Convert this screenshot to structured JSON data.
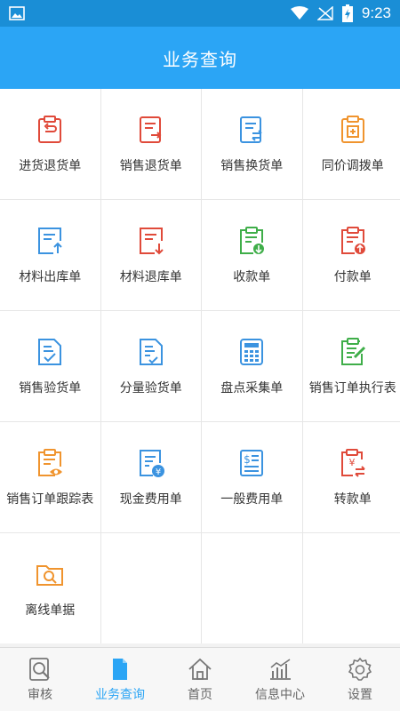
{
  "status_bar": {
    "time": "9:23"
  },
  "app_bar": {
    "title": "业务查询"
  },
  "grid": [
    {
      "label": "进货退货单",
      "icon": "return-purchase-icon",
      "color": "#e04a3a"
    },
    {
      "label": "销售退货单",
      "icon": "sales-return-icon",
      "color": "#e04a3a"
    },
    {
      "label": "销售换货单",
      "icon": "sales-exchange-icon",
      "color": "#3b93e0"
    },
    {
      "label": "同价调拨单",
      "icon": "transfer-icon",
      "color": "#f0942e"
    },
    {
      "label": "材料出库单",
      "icon": "material-out-icon",
      "color": "#3b93e0"
    },
    {
      "label": "材料退库单",
      "icon": "material-return-icon",
      "color": "#e04a3a"
    },
    {
      "label": "收款单",
      "icon": "receipt-icon",
      "color": "#3fae49"
    },
    {
      "label": "付款单",
      "icon": "payment-icon",
      "color": "#e04a3a"
    },
    {
      "label": "销售验货单",
      "icon": "sales-inspection-icon",
      "color": "#3b93e0"
    },
    {
      "label": "分量验货单",
      "icon": "partial-inspection-icon",
      "color": "#3b93e0"
    },
    {
      "label": "盘点采集单",
      "icon": "inventory-icon",
      "color": "#3b93e0"
    },
    {
      "label": "销售订单执行表",
      "icon": "order-execution-icon",
      "color": "#3fae49"
    },
    {
      "label": "销售订单跟踪表",
      "icon": "order-tracking-icon",
      "color": "#f0942e"
    },
    {
      "label": "现金费用单",
      "icon": "cash-expense-icon",
      "color": "#3b93e0"
    },
    {
      "label": "一般费用单",
      "icon": "general-expense-icon",
      "color": "#3b93e0"
    },
    {
      "label": "转款单",
      "icon": "transfer-funds-icon",
      "color": "#e04a3a"
    },
    {
      "label": "离线单据",
      "icon": "offline-docs-icon",
      "color": "#f0942e"
    }
  ],
  "tabs": [
    {
      "label": "审核",
      "icon": "audit-icon",
      "active": false
    },
    {
      "label": "业务查询",
      "icon": "document-icon",
      "active": true
    },
    {
      "label": "首页",
      "icon": "home-icon",
      "active": false
    },
    {
      "label": "信息中心",
      "icon": "chart-icon",
      "active": false
    },
    {
      "label": "设置",
      "icon": "gear-icon",
      "active": false
    }
  ],
  "colors": {
    "accent": "#2ba5f5",
    "status_bar": "#1a8ed6"
  }
}
